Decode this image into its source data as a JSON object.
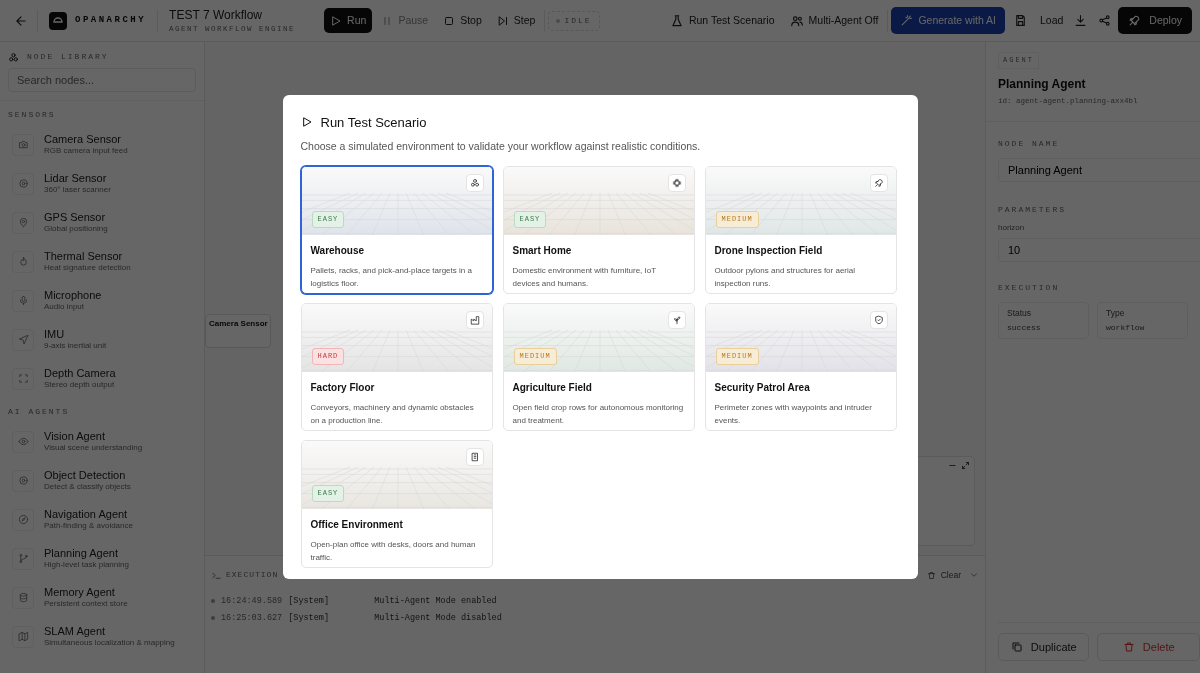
{
  "topbar": {
    "app_name": "OPANARCHY",
    "title": "TEST 7 Workflow",
    "subtitle": "AGENT WORKFLOW ENGINE",
    "controls": [
      {
        "label": "Run",
        "kind": "run",
        "disabled": false
      },
      {
        "label": "Pause",
        "kind": "pause",
        "disabled": true
      },
      {
        "label": "Stop",
        "kind": "stop",
        "disabled": false
      },
      {
        "label": "Step",
        "kind": "step",
        "disabled": false
      }
    ],
    "status": "IDLE",
    "actions": [
      {
        "label": "Run Test Scenario",
        "kind": "scenario"
      },
      {
        "label": "Multi-Agent Off",
        "kind": "multi"
      },
      {
        "label": "Generate with AI",
        "kind": "ai"
      },
      {
        "label": "Load",
        "kind": "load"
      },
      {
        "label": "Deploy",
        "kind": "deploy"
      }
    ]
  },
  "sidebar": {
    "heading": "NODE LIBRARY",
    "search": {
      "placeholder": "Search nodes..."
    },
    "categories": [
      {
        "name": "SENSORS",
        "items": [
          {
            "title": "Camera Sensor",
            "description": "RGB camera input feed"
          },
          {
            "title": "Lidar Sensor",
            "description": "360° laser scanner"
          },
          {
            "title": "GPS Sensor",
            "description": "Global positioning"
          },
          {
            "title": "Thermal Sensor",
            "description": "Heat signature detection"
          },
          {
            "title": "Microphone",
            "description": "Audio input"
          },
          {
            "title": "IMU",
            "description": "9-axis inertial unit"
          },
          {
            "title": "Depth Camera",
            "description": "Stereo depth output"
          }
        ]
      },
      {
        "name": "AI AGENTS",
        "items": [
          {
            "title": "Vision Agent",
            "description": "Visual scene understanding"
          },
          {
            "title": "Object Detection",
            "description": "Detect & classify objects"
          },
          {
            "title": "Navigation Agent",
            "description": "Path-finding & avoidance"
          },
          {
            "title": "Planning Agent",
            "description": "High-level task planning"
          },
          {
            "title": "Memory Agent",
            "description": "Persistent context store"
          },
          {
            "title": "SLAM Agent",
            "description": "Simultaneous localization & mapping"
          }
        ]
      }
    ]
  },
  "canvas": {
    "node": {
      "title": "Camera Sensor"
    }
  },
  "execution_log": {
    "title": "EXECUTION",
    "clear": "Clear",
    "entries": [
      {
        "time": "16:24:49.589",
        "source": "[System]",
        "message": "Multi-Agent Mode enabled"
      },
      {
        "time": "16:25:03.627",
        "source": "[System]",
        "message": "Multi-Agent Mode disabled"
      }
    ]
  },
  "inspector": {
    "badge": "AGENT",
    "title": "Planning Agent",
    "id": "id: agent-agent.planning-axx4bl",
    "node_name_label": "NODE NAME",
    "node_name": "Planning Agent",
    "parameters_label": "PARAMETERS",
    "parameters": [
      {
        "name": "horizon",
        "value": "10"
      }
    ],
    "execution_label": "EXECUTION",
    "stats": [
      {
        "label": "Status",
        "value": "success"
      },
      {
        "label": "Type",
        "value": "workflow"
      }
    ],
    "duplicate": "Duplicate",
    "delete": "Delete"
  },
  "modal": {
    "title": "Run Test Scenario",
    "subtitle": "Choose a simulated environment to validate your workflow against realistic conditions.",
    "scenarios": [
      {
        "name": "Warehouse",
        "description": "Pallets, racks, and pick-and-place targets in a logistics floor.",
        "difficulty": "EASY",
        "kind": "easy",
        "selected": true,
        "color": "#dfe3ea"
      },
      {
        "name": "Smart Home",
        "description": "Domestic environment with furniture, IoT devices and humans.",
        "difficulty": "EASY",
        "kind": "easy",
        "selected": false,
        "color": "#e8e3db"
      },
      {
        "name": "Drone Inspection Field",
        "description": "Outdoor pylons and structures for aerial inspection runs.",
        "difficulty": "MEDIUM",
        "kind": "medium",
        "selected": false,
        "color": "#e0e6e6"
      },
      {
        "name": "Factory Floor",
        "description": "Conveyors, machinery and dynamic obstacles on a production line.",
        "difficulty": "HARD",
        "kind": "hard",
        "selected": false,
        "color": "#e4e4e4"
      },
      {
        "name": "Agriculture Field",
        "description": "Open field crop rows for autonomous monitoring and treatment.",
        "difficulty": "MEDIUM",
        "kind": "medium",
        "selected": false,
        "color": "#dfe8e2"
      },
      {
        "name": "Security Patrol Area",
        "description": "Perimeter zones with waypoints and intruder events.",
        "difficulty": "MEDIUM",
        "kind": "medium",
        "selected": false,
        "color": "#e2e1e8"
      },
      {
        "name": "Office Environment",
        "description": "Open-plan office with desks, doors and human traffic.",
        "difficulty": "EASY",
        "kind": "easy",
        "selected": false,
        "color": "#e9e6e1"
      }
    ]
  }
}
